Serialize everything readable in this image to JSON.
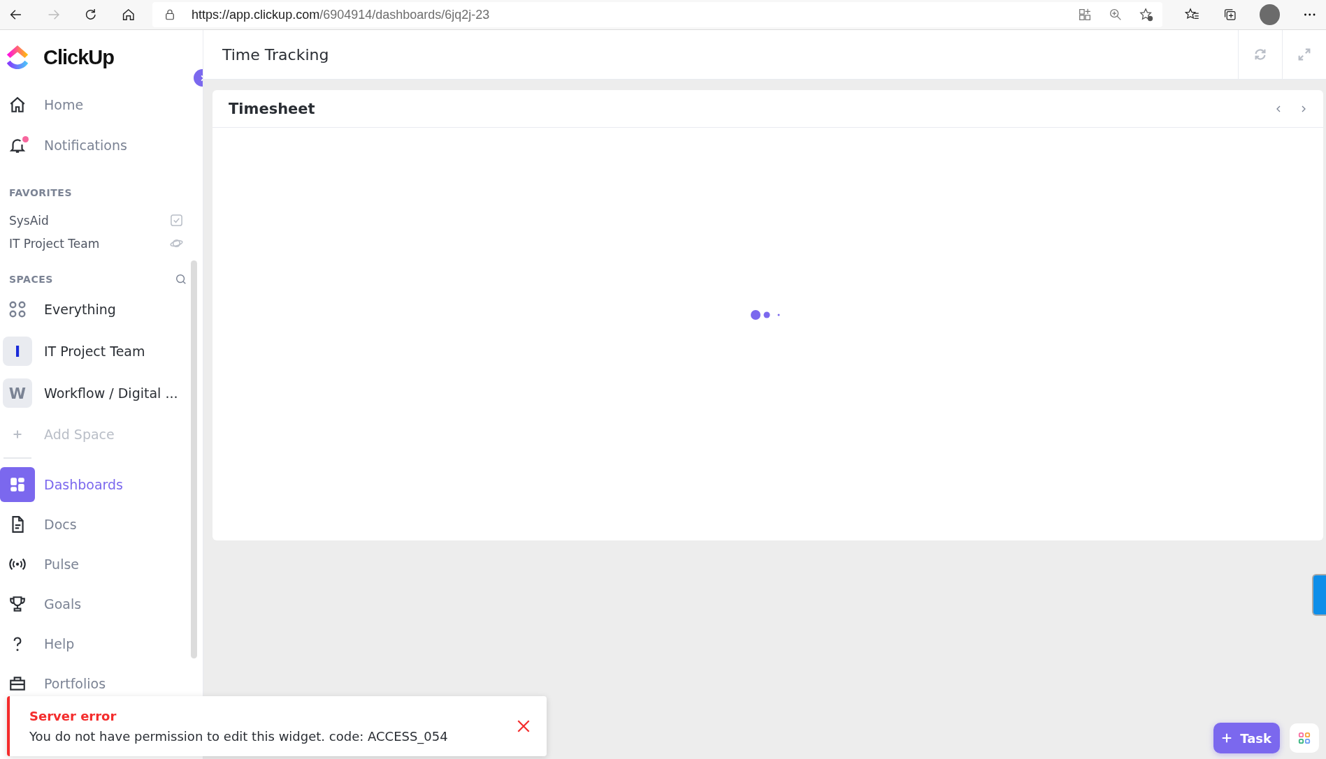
{
  "browser": {
    "url_host": "https://app.clickup.com",
    "url_path": "/6904914/dashboards/6jq2j-23"
  },
  "sidebar": {
    "logo": "ClickUp",
    "top_items": [
      {
        "kind": "home",
        "label": "Home"
      },
      {
        "kind": "bell",
        "label": "Notifications",
        "unread": true
      }
    ],
    "favorites": {
      "heading": "FAVORITES",
      "items": [
        {
          "kind": "check",
          "label": "SysAid"
        },
        {
          "kind": "planet",
          "label": "IT Project Team"
        }
      ]
    },
    "spaces": {
      "heading": "SPACES",
      "items": [
        {
          "kind": "everything",
          "label": "Everything"
        },
        {
          "kind": "space",
          "label": "IT Project Team",
          "letter": "I",
          "color": "#1a2bd9"
        },
        {
          "kind": "space",
          "label": "Workflow / Digital ...",
          "letter": "W",
          "color": "#7b8394"
        }
      ],
      "add": "Add Space"
    },
    "nav": [
      {
        "kind": "dashboards",
        "label": "Dashboards",
        "selected": true
      },
      {
        "kind": "docs",
        "label": "Docs",
        "selected": false
      },
      {
        "kind": "pulse",
        "label": "Pulse",
        "selected": false
      },
      {
        "kind": "goals",
        "label": "Goals",
        "selected": false
      },
      {
        "kind": "help",
        "label": "Help",
        "selected": false
      },
      {
        "kind": "portfolios",
        "label": "Portfolios",
        "selected": false
      }
    ]
  },
  "main": {
    "title": "Time Tracking",
    "widget": {
      "title": "Timesheet"
    }
  },
  "toast": {
    "title": "Server error",
    "message": "You do not have permission to edit this widget. code: ACCESS_054"
  },
  "task_button": {
    "label": "Task"
  }
}
